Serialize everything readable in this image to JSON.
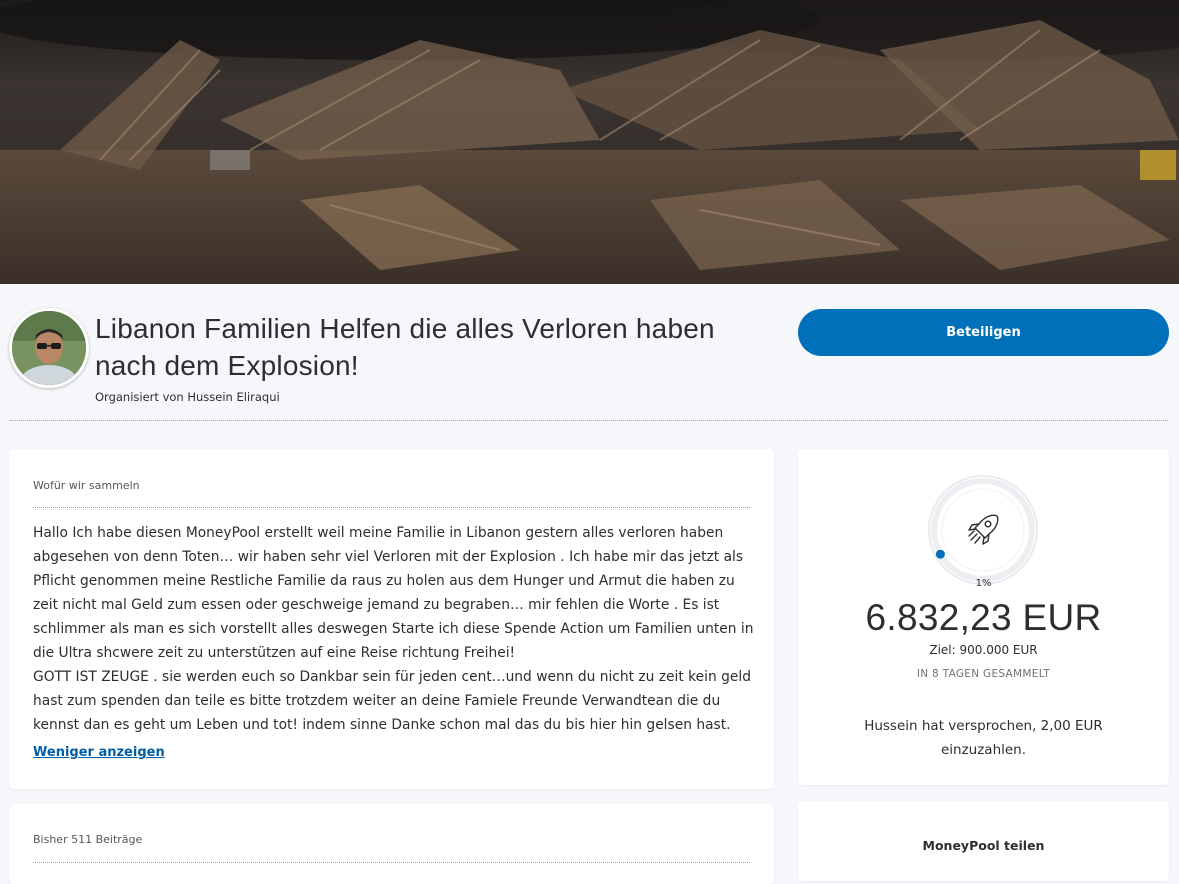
{
  "campaign": {
    "title": "Libanon Familien Helfen die alles Verloren haben nach dem Explosion!",
    "organizer_line": "Organisiert von Hussein Eliraqui",
    "cta_label": "Beteiligen"
  },
  "story": {
    "section_label": "Wofür wir sammeln",
    "text": "Hallo Ich habe diesen MoneyPool erstellt weil meine Familie in Libanon gestern alles verloren haben abgesehen von denn Toten… wir haben sehr viel Verloren mit der Explosion . Ich habe mir das jetzt als Pflicht genommen meine Restliche Familie da raus zu holen aus dem Hunger und Armut die haben zu zeit nicht mal Geld zum essen oder geschweige jemand zu begraben… mir fehlen die Worte . Es ist schlimmer als man es sich vorstellt alles deswegen Starte ich diese Spende Action um Familien unten in die Ultra shcwere zeit zu unterstützen auf eine Reise richtung Freihei!\nGOTT IST ZEUGE . sie werden euch so Dankbar sein für jeden cent…und wenn du nicht zu zeit kein geld hast zum spenden dan teile es bitte trotzdem weiter an deine Famiele Freunde Verwandtean die du kennst dan es geht um Leben und tot! indem sinne Danke schon mal das du bis hier hin gelsen hast.",
    "toggle_label": "Weniger anzeigen"
  },
  "contributions": {
    "section_label": "Bisher 511 Beiträge"
  },
  "progress": {
    "percent_label": "1%",
    "percent_value": 0.76,
    "amount": "6.832,23 EUR",
    "goal": "Ziel: 900.000 EUR",
    "days": "IN 8 TAGEN GESAMMELT",
    "pledge": "Hussein hat versprochen, 2,00 EUR einzuzahlen.",
    "icon": "rocket-icon",
    "accent_color": "#0070ba"
  },
  "share": {
    "title": "MoneyPool teilen"
  }
}
